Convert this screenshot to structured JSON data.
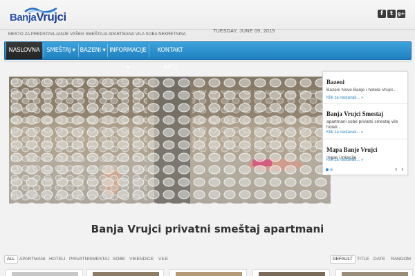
{
  "header": {
    "logo_part1": "Banja",
    "logo_part2": "Vrujci",
    "tagline": "Mesto za predstavljanje vašeg smeštaja apartmana vila soba nekretnina",
    "date": "TUESDAY, JUNE 09, 2015",
    "social": [
      {
        "icon": "facebook-icon",
        "glyph": "f"
      },
      {
        "icon": "twitter-icon",
        "glyph": "t"
      },
      {
        "icon": "google-plus-icon",
        "glyph": "g+"
      }
    ]
  },
  "nav": {
    "items": [
      {
        "label": "NASLOVNA"
      },
      {
        "label": "SMEŠTAJ ▾"
      },
      {
        "label": "BAZENI ▾"
      },
      {
        "label": "INFORMACIJE ▾"
      },
      {
        "label": "KONTAKT INFO"
      }
    ]
  },
  "slider": {
    "items": [
      {
        "title": "Bazeni",
        "desc": "Bazeni Nove Banje i hotela Vrujci...",
        "more": "Klik za nastavak... »"
      },
      {
        "title": "Banja Vrujci Smestaj",
        "desc": "apartmani sobe privatni smestaj vile hoteli...",
        "more": "Klik za nastavak... »"
      },
      {
        "title": "Mapa Banje Vrujci",
        "desc": "mape i lokacije",
        "more": "Klik za nastavak... »"
      }
    ],
    "prev": "‹",
    "next": "›"
  },
  "main_title": "Banja Vrujci privatni smeštaj apartmani",
  "filters": {
    "categories": [
      "ALL",
      "APARTMANI",
      "HOTELI",
      "PRIVATNISMESTAJ",
      "SOBE",
      "VIKENDICE",
      "VILE"
    ],
    "sort": [
      "DEFAULT",
      "TITLE",
      "DATE",
      "RANDOM"
    ]
  },
  "colors": {
    "nav_blue": "#2a8fd0",
    "link_blue": "#2a88c7"
  }
}
